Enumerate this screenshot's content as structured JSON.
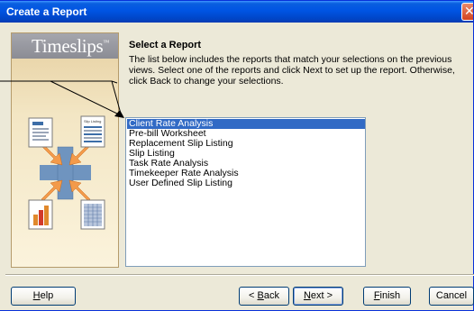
{
  "window": {
    "title": "Create a Report"
  },
  "sidebar": {
    "logo": "Timeslips",
    "logo_mark": "™",
    "thumb_label": "Slip Listing"
  },
  "header": {
    "title": "Select a Report",
    "instructions": "The list below includes the reports that match your selections on the previous views. Select one of the reports and click Next to set up the report. Otherwise, click Back to change your selections."
  },
  "reports": {
    "selected": "Client Rate Analysis",
    "items": [
      "Client Rate Analysis",
      "Pre-bill Worksheet",
      "Replacement Slip Listing",
      "Slip Listing",
      "Task Rate Analysis",
      "Timekeeper Rate Analysis",
      "User Defined Slip Listing"
    ]
  },
  "buttons": {
    "help": {
      "pre": "",
      "key": "H",
      "post": "elp"
    },
    "back": {
      "pre": "< ",
      "key": "B",
      "post": "ack"
    },
    "next": {
      "pre": "",
      "key": "N",
      "post": "ext >"
    },
    "finish": {
      "pre": "",
      "key": "F",
      "post": "inish"
    },
    "cancel": {
      "pre": "",
      "key": "",
      "post": "Cancel"
    }
  },
  "colors": {
    "title_bar": "#0054e3",
    "selection": "#316ac5",
    "accent_orange": "#f39a4a",
    "plus_blue": "#6f94bf"
  }
}
